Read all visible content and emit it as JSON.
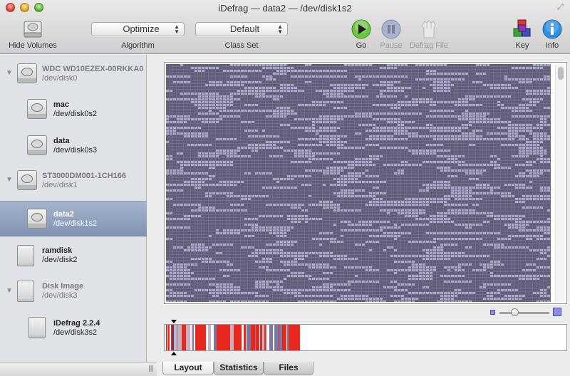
{
  "window": {
    "title": "iDefrag — data2 — /dev/disk1s2"
  },
  "toolbar": {
    "hide_volumes": "Hide Volumes",
    "algorithm": {
      "label": "Algorithm",
      "selected": "Optimize"
    },
    "class_set": {
      "label": "Class Set",
      "selected": "Default"
    },
    "go": "Go",
    "pause": "Pause",
    "defrag_file": "Defrag File",
    "key": "Key",
    "info": "Info"
  },
  "sidebar": {
    "volumes": [
      {
        "name": "WDC WD10EZEX-00RKKA0",
        "dev": "/dev/disk0",
        "kind": "group",
        "expanded": true
      },
      {
        "name": "mac",
        "dev": "/dev/disk0s2",
        "kind": "partition"
      },
      {
        "name": "data",
        "dev": "/dev/disk0s3",
        "kind": "partition"
      },
      {
        "name": "ST3000DM001-1CH166",
        "dev": "/dev/disk1",
        "kind": "group",
        "expanded": true
      },
      {
        "name": "data2",
        "dev": "/dev/disk1s2",
        "kind": "partition",
        "selected": true
      },
      {
        "name": "ramdisk",
        "dev": "/dev/disk2",
        "kind": "disk"
      },
      {
        "name": "Disk Image",
        "dev": "/dev/disk3",
        "kind": "group",
        "expanded": true
      },
      {
        "name": "iDefrag 2.2.4",
        "dev": "/dev/disk3s2",
        "kind": "partition"
      }
    ]
  },
  "tabs": [
    {
      "label": "Layout",
      "active": true
    },
    {
      "label": "Statistics",
      "active": false
    },
    {
      "label": "Files",
      "active": false
    }
  ],
  "colors": {
    "used_block": "#6e6c86",
    "free_block": "#a9a8c8",
    "fragmented": "#e8281e",
    "selection": "#8193b0",
    "accent_go": "#5fb83a",
    "accent_info": "#2f8fe0"
  }
}
